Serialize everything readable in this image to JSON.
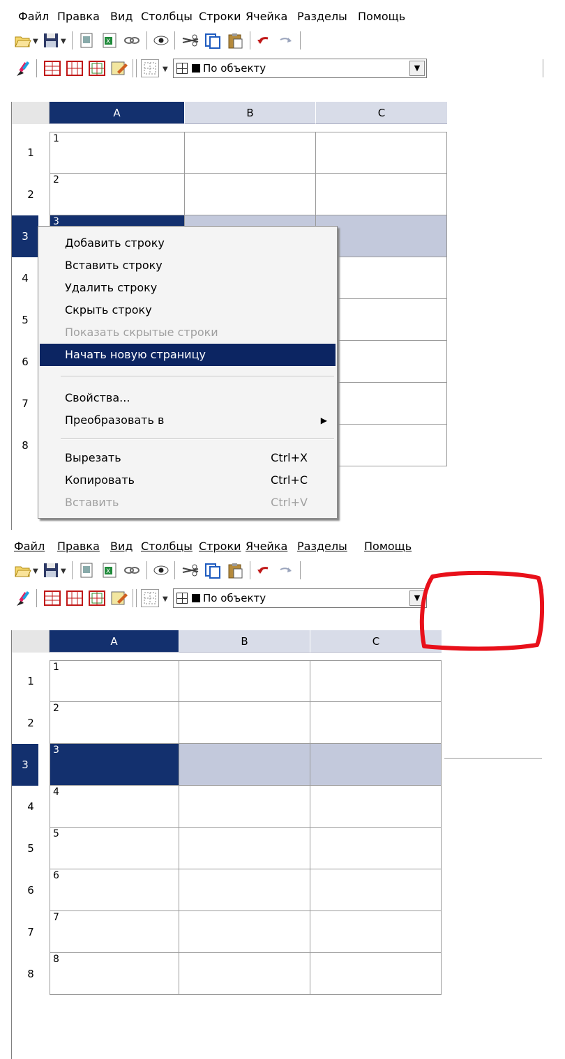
{
  "top": {
    "menu": [
      "Файл",
      "Правка",
      "Вид",
      "Столбцы",
      "Строки",
      "Ячейка",
      "Разделы",
      "Помощь"
    ],
    "border_combo": "По объекту",
    "columns": [
      "A",
      "B",
      "C"
    ],
    "rows": [
      "1",
      "2",
      "3",
      "4",
      "5",
      "6",
      "7",
      "8"
    ],
    "cells": [
      "1",
      "2",
      "3"
    ],
    "context_menu": {
      "add_row": "Добавить строку",
      "insert_row": "Вставить строку",
      "delete_row": "Удалить строку",
      "hide_row": "Скрыть строку",
      "show_hidden": "Показать скрытые строки",
      "new_page": "Начать новую страницу",
      "properties": "Свойства...",
      "convert": "Преобразовать в",
      "cut": "Вырезать",
      "cut_shortcut": "Ctrl+X",
      "copy": "Копировать",
      "copy_shortcut": "Ctrl+C",
      "paste": "Вставить",
      "paste_shortcut": "Ctrl+V"
    }
  },
  "bottom": {
    "menu": [
      "Файл",
      "Правка",
      "Вид",
      "Столбцы",
      "Строки",
      "Ячейка",
      "Разделы",
      "Помощь"
    ],
    "border_combo": "По объекту",
    "columns": [
      "A",
      "B",
      "C"
    ],
    "rows": [
      "1",
      "2",
      "3",
      "4",
      "5",
      "6",
      "7",
      "8"
    ],
    "cells": [
      "1",
      "2",
      "3",
      "4",
      "5",
      "6",
      "7",
      "8"
    ]
  },
  "colors": {
    "selection": "#13306e",
    "row_highlight": "#c3c9dc",
    "menu_highlight": "#0c2562",
    "annotation": "#e8101a"
  }
}
